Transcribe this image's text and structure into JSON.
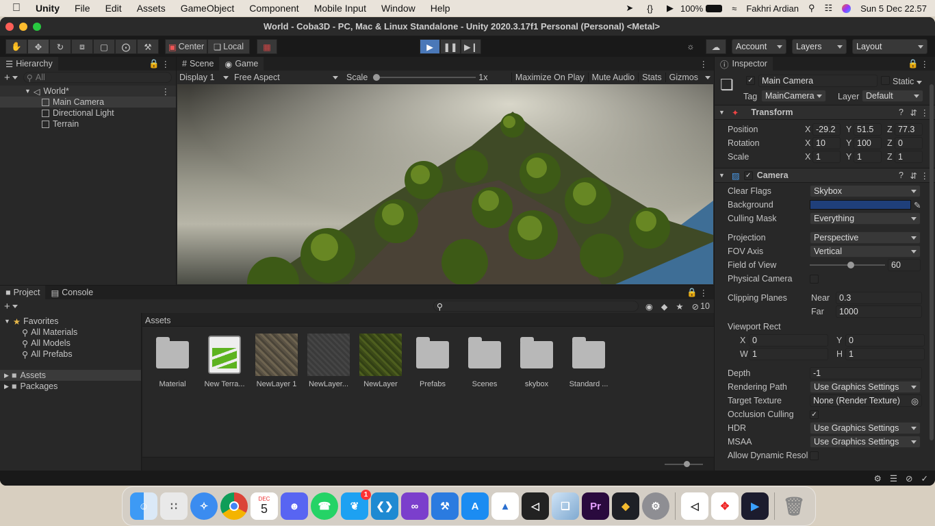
{
  "menubar": {
    "app": "Unity",
    "items": [
      "File",
      "Edit",
      "Assets",
      "GameObject",
      "Component",
      "Mobile Input",
      "Window",
      "Help"
    ],
    "battery": "100%",
    "user": "Fakhri Ardian",
    "datetime": "Sun 5 Dec  22.57"
  },
  "window": {
    "title": "World - Coba3D - PC, Mac & Linux Standalone - Unity 2020.3.17f1 Personal (Personal) <Metal>"
  },
  "toolbar": {
    "center": "Center",
    "local": "Local",
    "account": "Account",
    "layers": "Layers",
    "layout": "Layout"
  },
  "hierarchy": {
    "tab": "Hierarchy",
    "search_placeholder": "All",
    "scene": "World*",
    "items": [
      "Main Camera",
      "Directional Light",
      "Terrain"
    ]
  },
  "scene_tabs": {
    "scene": "Scene",
    "game": "Game"
  },
  "game_bar": {
    "display": "Display 1",
    "aspect": "Free Aspect",
    "scale_label": "Scale",
    "scale_value": "1x",
    "maximize": "Maximize On Play",
    "mute": "Mute Audio",
    "stats": "Stats",
    "gizmos": "Gizmos"
  },
  "project": {
    "tab_project": "Project",
    "tab_console": "Console",
    "hidden_count": "10",
    "favorites": "Favorites",
    "fav_items": [
      "All Materials",
      "All Models",
      "All Prefabs"
    ],
    "roots": [
      "Assets",
      "Packages"
    ],
    "breadcrumb": "Assets",
    "assets": [
      {
        "name": "Material",
        "kind": "folder"
      },
      {
        "name": "New Terra...",
        "kind": "terrain"
      },
      {
        "name": "NewLayer 1",
        "kind": "tex1"
      },
      {
        "name": "NewLayer...",
        "kind": "tex2"
      },
      {
        "name": "NewLayer",
        "kind": "tex3"
      },
      {
        "name": "Prefabs",
        "kind": "folder"
      },
      {
        "name": "Scenes",
        "kind": "folder"
      },
      {
        "name": "skybox",
        "kind": "folder"
      },
      {
        "name": "Standard ...",
        "kind": "folder"
      }
    ]
  },
  "inspector": {
    "tab": "Inspector",
    "object_name": "Main Camera",
    "static": "Static",
    "tag_label": "Tag",
    "tag": "MainCamera",
    "layer_label": "Layer",
    "layer": "Default",
    "transform": {
      "title": "Transform",
      "position_label": "Position",
      "rotation_label": "Rotation",
      "scale_label": "Scale",
      "pos": [
        "-29.2",
        "51.5",
        "77.3"
      ],
      "rot": [
        "10",
        "100",
        "0"
      ],
      "scl": [
        "1",
        "1",
        "1"
      ]
    },
    "camera": {
      "title": "Camera",
      "clear_flags_label": "Clear Flags",
      "clear_flags": "Skybox",
      "background_label": "Background",
      "background_color": "#1f3f7a",
      "culling_label": "Culling Mask",
      "culling": "Everything",
      "projection_label": "Projection",
      "projection": "Perspective",
      "fov_axis_label": "FOV Axis",
      "fov_axis": "Vertical",
      "fov_label": "Field of View",
      "fov": "60",
      "fov_fraction": 0.5,
      "physical_label": "Physical Camera",
      "clipping_label": "Clipping Planes",
      "near_label": "Near",
      "near": "0.3",
      "far_label": "Far",
      "far": "1000",
      "viewport_label": "Viewport Rect",
      "vx": "0",
      "vy": "0",
      "vw": "1",
      "vh": "1",
      "depth_label": "Depth",
      "depth": "-1",
      "rendering_label": "Rendering Path",
      "rendering": "Use Graphics Settings",
      "target_label": "Target Texture",
      "target": "None (Render Texture)",
      "occlusion_label": "Occlusion Culling",
      "hdr_label": "HDR",
      "hdr": "Use Graphics Settings",
      "msaa_label": "MSAA",
      "msaa": "Use Graphics Settings",
      "dynres_label": "Allow Dynamic Resol"
    }
  },
  "dock": {
    "calendar_month": "DEC",
    "calendar_day": "5",
    "twitter_badge": "1",
    "premiere": "Pr"
  }
}
